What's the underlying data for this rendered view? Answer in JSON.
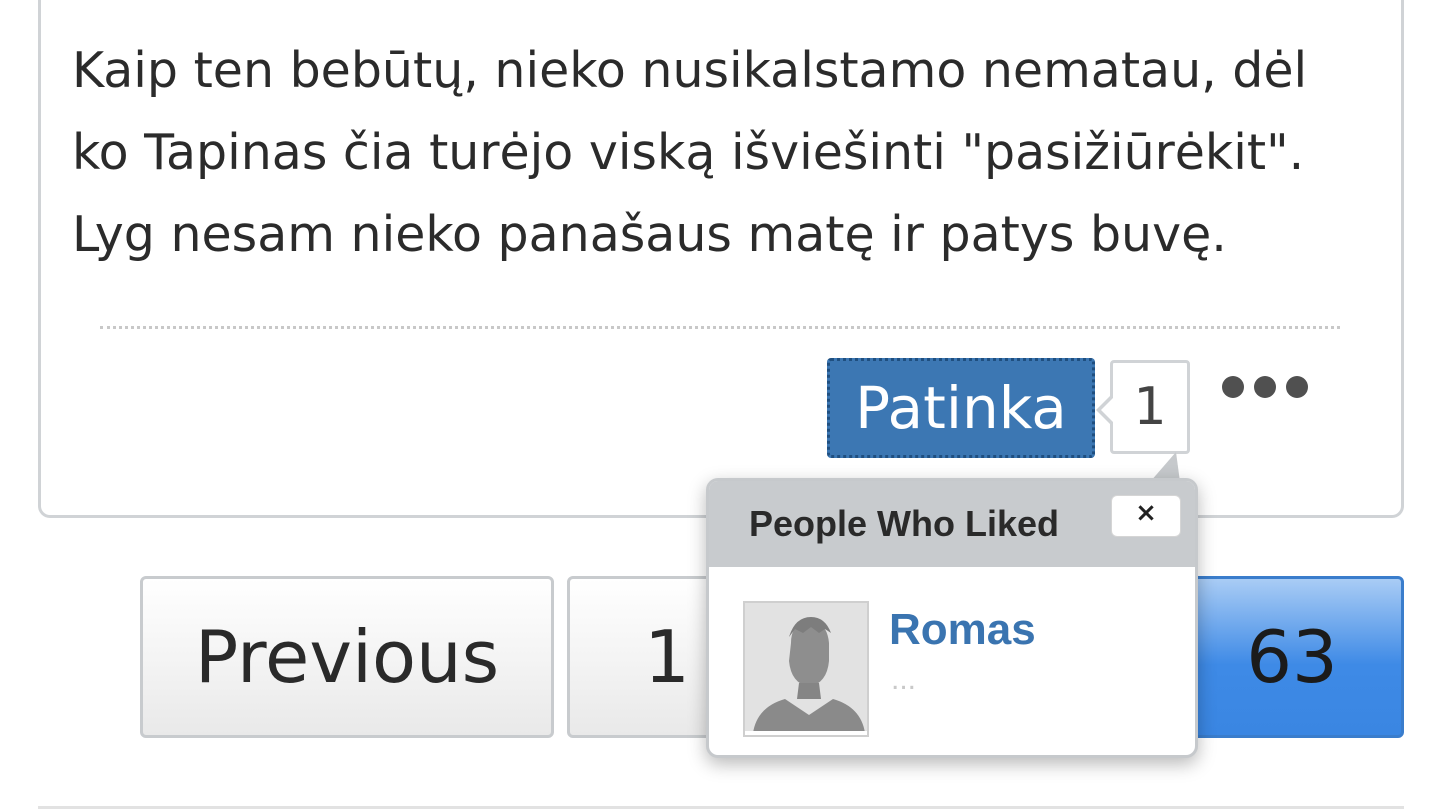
{
  "post": {
    "lines": [
      "Kaip ten bebūtų, nieko nusikalstamo nematau, dėl",
      "ko Tapinas čia turėjo viską išviešinti \"pasižiūrėkit\".",
      "Lyg nesam nieko panašaus matę ir patys buvę."
    ]
  },
  "actions": {
    "like_label": "Patinka",
    "like_count": "1",
    "more_icon": "ellipsis-icon"
  },
  "pagination": {
    "previous_label": "Previous",
    "first_page": "1",
    "current_page": "63"
  },
  "likes_popup": {
    "title": "People Who Liked",
    "close_label": "×",
    "users": [
      {
        "name": "Romas",
        "meta": "...",
        "avatar_icon": "default-avatar-icon"
      }
    ]
  },
  "colors": {
    "like_button": "#3c77b3",
    "username": "#3a74b0",
    "current_page": "#3e8ae6",
    "popup_header": "#c8cbce"
  }
}
